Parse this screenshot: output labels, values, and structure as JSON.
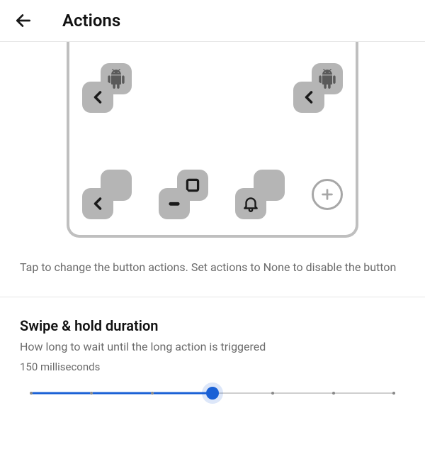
{
  "header": {
    "title": "Actions"
  },
  "preview": {
    "top_buttons": [
      {
        "id": "left-top",
        "front_icon": "chevron-left",
        "back_icon": "android"
      },
      {
        "id": "right-top",
        "front_icon": "chevron-left",
        "back_icon": "android"
      }
    ],
    "bottom_buttons": [
      {
        "id": "btn1",
        "front_icon": "chevron-left",
        "back_icon": "blank"
      },
      {
        "id": "btn2",
        "front_icon": "pill",
        "back_icon": "square-outline"
      },
      {
        "id": "btn3",
        "front_icon": "bell",
        "back_icon": "blank"
      }
    ]
  },
  "hint": "Tap to change the button actions. Set actions to None to disable the button",
  "setting": {
    "title": "Swipe & hold duration",
    "description": "How long to wait until the long action is triggered",
    "value_text": "150 milliseconds",
    "slider": {
      "ticks": 7,
      "position": 3
    }
  }
}
